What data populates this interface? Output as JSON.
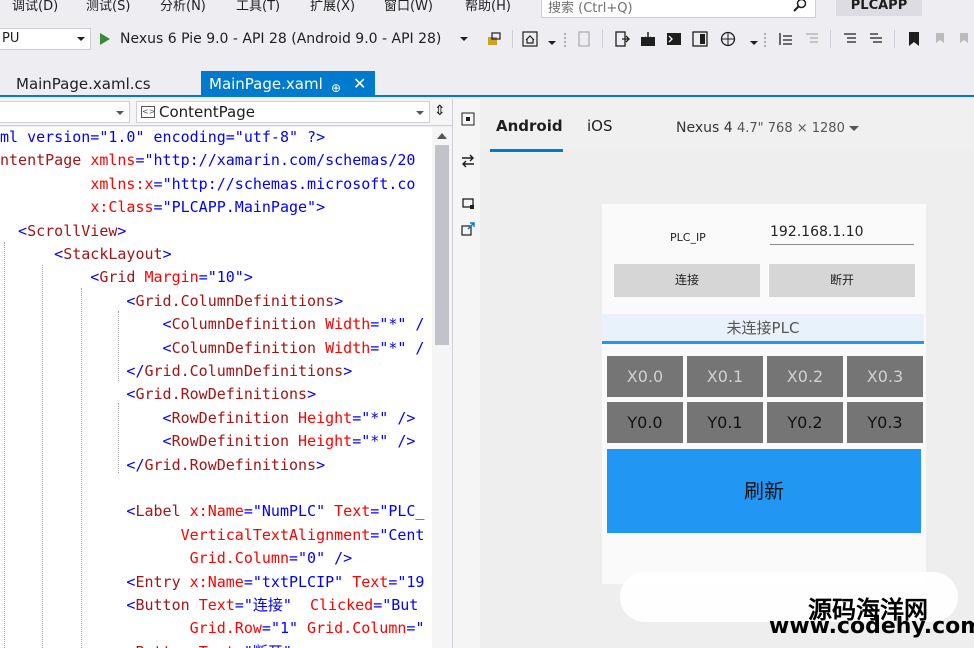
{
  "menu": {
    "items": [
      "调试(D)",
      "测试(S)",
      "分析(N)",
      "工具(T)",
      "扩展(X)",
      "窗口(W)",
      "帮助(H)"
    ],
    "search_placeholder": "搜索 (Ctrl+Q)",
    "app_name": "PLCAPP"
  },
  "toolbar": {
    "platform": "PU",
    "run_target": "Nexus 6 Pie 9.0 - API 28 (Android 9.0 - API 28)"
  },
  "tabs": [
    {
      "label": "MainPage.xaml.cs",
      "active": false
    },
    {
      "label": "MainPage.xaml",
      "active": true
    }
  ],
  "editor": {
    "nav_left": "",
    "nav_right": "ContentPage",
    "lines": [
      [
        [
          "pi",
          "ml version=\"1.0\" encoding=\"utf-8\" ?>"
        ]
      ],
      [
        [
          "tag",
          "ntentPage "
        ],
        [
          "attr",
          "xmlns"
        ],
        [
          "delim",
          "="
        ],
        [
          "val",
          "\"http://xamarin.com/schemas/20"
        ]
      ],
      [
        [
          "sp",
          "          "
        ],
        [
          "attr",
          "xmlns:x"
        ],
        [
          "delim",
          "="
        ],
        [
          "val",
          "\"http://schemas.microsoft.co"
        ]
      ],
      [
        [
          "sp",
          "          "
        ],
        [
          "attr",
          "x:Class"
        ],
        [
          "delim",
          "="
        ],
        [
          "val",
          "\"PLCAPP.MainPage\""
        ],
        [
          "delim",
          ">"
        ]
      ],
      [
        [
          "delim",
          "  <"
        ],
        [
          "tag",
          "ScrollView"
        ],
        [
          "delim",
          ">"
        ]
      ],
      [
        [
          "delim",
          "      <"
        ],
        [
          "tag",
          "StackLayout"
        ],
        [
          "delim",
          ">"
        ]
      ],
      [
        [
          "delim",
          "          <"
        ],
        [
          "tag",
          "Grid "
        ],
        [
          "attr",
          "Margin"
        ],
        [
          "delim",
          "="
        ],
        [
          "val",
          "\"10\""
        ],
        [
          "delim",
          ">"
        ]
      ],
      [
        [
          "delim",
          "              <"
        ],
        [
          "tag",
          "Grid.ColumnDefinitions"
        ],
        [
          "delim",
          ">"
        ]
      ],
      [
        [
          "delim",
          "                  <"
        ],
        [
          "tag",
          "ColumnDefinition "
        ],
        [
          "attr",
          "Width"
        ],
        [
          "delim",
          "="
        ],
        [
          "val",
          "\"*\""
        ],
        [
          "delim",
          " /"
        ]
      ],
      [
        [
          "delim",
          "                  <"
        ],
        [
          "tag",
          "ColumnDefinition "
        ],
        [
          "attr",
          "Width"
        ],
        [
          "delim",
          "="
        ],
        [
          "val",
          "\"*\""
        ],
        [
          "delim",
          " /"
        ]
      ],
      [
        [
          "delim",
          "              </"
        ],
        [
          "tag",
          "Grid.ColumnDefinitions"
        ],
        [
          "delim",
          ">"
        ]
      ],
      [
        [
          "delim",
          "              <"
        ],
        [
          "tag",
          "Grid.RowDefinitions"
        ],
        [
          "delim",
          ">"
        ]
      ],
      [
        [
          "delim",
          "                  <"
        ],
        [
          "tag",
          "RowDefinition "
        ],
        [
          "attr",
          "Height"
        ],
        [
          "delim",
          "="
        ],
        [
          "val",
          "\"*\""
        ],
        [
          "delim",
          " />"
        ]
      ],
      [
        [
          "delim",
          "                  <"
        ],
        [
          "tag",
          "RowDefinition "
        ],
        [
          "attr",
          "Height"
        ],
        [
          "delim",
          "="
        ],
        [
          "val",
          "\"*\""
        ],
        [
          "delim",
          " />"
        ]
      ],
      [
        [
          "delim",
          "              </"
        ],
        [
          "tag",
          "Grid.RowDefinitions"
        ],
        [
          "delim",
          ">"
        ]
      ],
      [],
      [
        [
          "delim",
          "              <"
        ],
        [
          "tag",
          "Label "
        ],
        [
          "attr",
          "x:Name"
        ],
        [
          "delim",
          "="
        ],
        [
          "val",
          "\"NumPLC\""
        ],
        [
          "attr",
          " Text"
        ],
        [
          "delim",
          "="
        ],
        [
          "val",
          "\"PLC_"
        ]
      ],
      [
        [
          "sp",
          "                    "
        ],
        [
          "attr",
          "VerticalTextAlignment"
        ],
        [
          "delim",
          "="
        ],
        [
          "val",
          "\"Cent"
        ]
      ],
      [
        [
          "sp",
          "                     "
        ],
        [
          "attr",
          "Grid.Column"
        ],
        [
          "delim",
          "="
        ],
        [
          "val",
          "\"0\""
        ],
        [
          "delim",
          " />"
        ]
      ],
      [
        [
          "delim",
          "              <"
        ],
        [
          "tag",
          "Entry "
        ],
        [
          "attr",
          "x:Name"
        ],
        [
          "delim",
          "="
        ],
        [
          "val",
          "\"txtPLCIP\""
        ],
        [
          "attr",
          " Text"
        ],
        [
          "delim",
          "="
        ],
        [
          "val",
          "\"19"
        ]
      ],
      [
        [
          "delim",
          "              <"
        ],
        [
          "tag",
          "Button "
        ],
        [
          "attr",
          "Text"
        ],
        [
          "delim",
          "="
        ],
        [
          "val",
          "\"连接\""
        ],
        [
          "attr",
          "  Clicked"
        ],
        [
          "delim",
          "="
        ],
        [
          "val",
          "\"But"
        ]
      ],
      [
        [
          "sp",
          "                     "
        ],
        [
          "attr",
          "Grid.Row"
        ],
        [
          "delim",
          "="
        ],
        [
          "val",
          "\"1\""
        ],
        [
          "attr",
          " Grid.Column"
        ],
        [
          "delim",
          "="
        ],
        [
          "val",
          "\""
        ]
      ],
      [
        [
          "delim",
          "              <"
        ],
        [
          "tag",
          "Button "
        ],
        [
          "attr",
          "Text"
        ],
        [
          "delim",
          "="
        ],
        [
          "val",
          "\"断开\""
        ]
      ]
    ]
  },
  "previewer": {
    "tabs": [
      "Android",
      "iOS"
    ],
    "device_name": "Nexus 4",
    "device_spec": "4.7\" 768 × 1280",
    "app": {
      "plc_ip_label": "PLC_IP",
      "plc_ip_value": "192.168.1.10",
      "connect_label": "连接",
      "disconnect_label": "断开",
      "status_text": "未连接PLC",
      "x_inputs": [
        "X0.0",
        "X0.1",
        "X0.2",
        "X0.3"
      ],
      "y_outputs": [
        "Y0.0",
        "Y0.1",
        "Y0.2",
        "Y0.3"
      ],
      "refresh_label": "刷新"
    }
  },
  "watermark": {
    "line1": "源码海洋网",
    "line2": "www.codehy.com"
  }
}
